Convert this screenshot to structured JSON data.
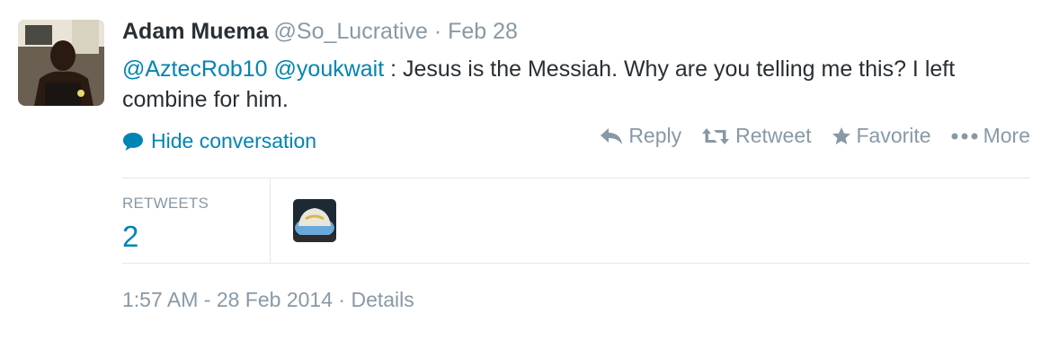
{
  "tweet": {
    "fullname": "Adam Muema",
    "username": "@So_Lucrative",
    "separator": "·",
    "date": "Feb 28",
    "mentions": [
      "@AztecRob10",
      "@youkwait"
    ],
    "text": " : Jesus is the Messiah. Why are you telling me this?  I left combine for him."
  },
  "conversation": {
    "hide_label": "Hide conversation",
    "icon": "speech-bubble-icon"
  },
  "actions": {
    "reply": "Reply",
    "retweet": "Retweet",
    "favorite": "Favorite",
    "more": "More"
  },
  "stats": {
    "retweets_label": "RETWEETS",
    "retweets_count": "2"
  },
  "meta": {
    "timestamp": "1:57 AM - 28 Feb 2014",
    "separator": "·",
    "details": "Details"
  },
  "colors": {
    "link": "#0084b4",
    "muted": "#8899a6",
    "text": "#292f33",
    "divider": "#e1e8ed"
  }
}
